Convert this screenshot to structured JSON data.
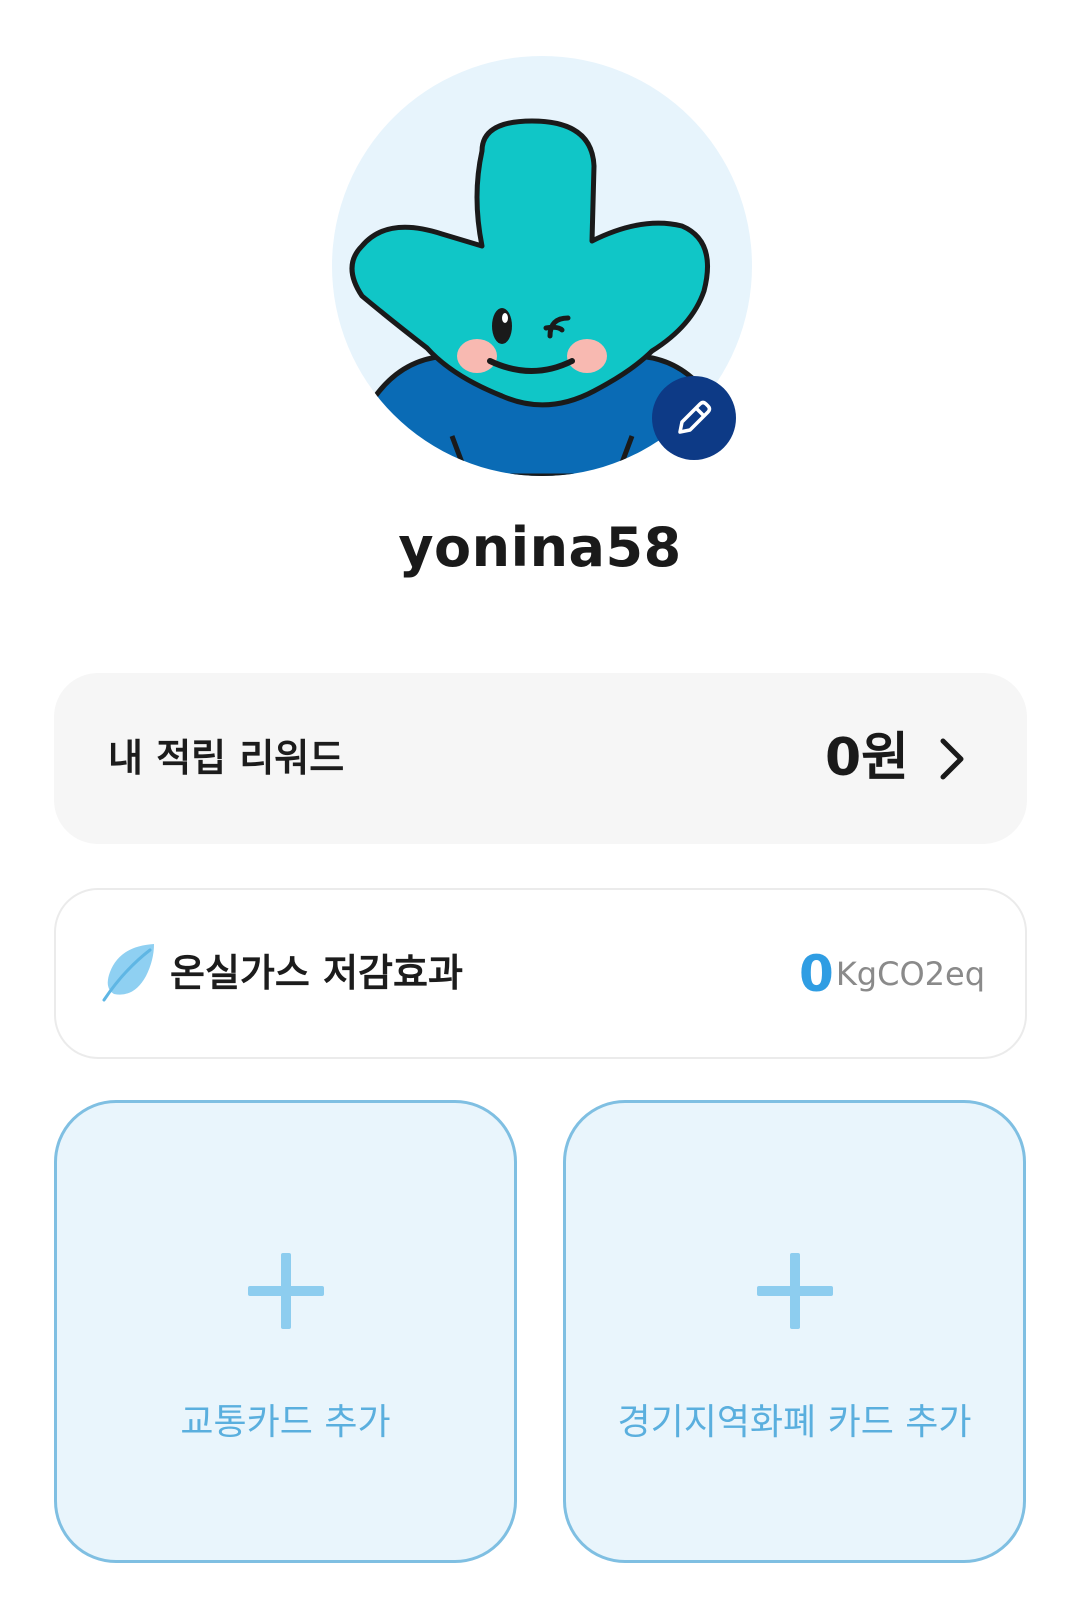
{
  "profile": {
    "username": "yonina58",
    "avatar_icon": "mascot-character-winking",
    "edit_icon": "pencil-icon",
    "avatar_bg": "#e7f4fc",
    "edit_badge_color": "#0d3a86"
  },
  "reward": {
    "label": "내 적립 리워드",
    "value": "0원",
    "chevron_icon": "chevron-right-icon"
  },
  "carbon": {
    "icon": "leaf-icon",
    "label": "온실가스 저감효과",
    "value": "0",
    "unit": "KgCO2eq",
    "value_color": "#2f9de3"
  },
  "cards": {
    "transit": {
      "icon": "plus-icon",
      "label": "교통카드 추가"
    },
    "local_currency": {
      "icon": "plus-icon",
      "label": "경기지역화폐 카드 추가"
    },
    "tile_bg": "#e9f5fc",
    "tile_border": "#7fbfe2"
  }
}
